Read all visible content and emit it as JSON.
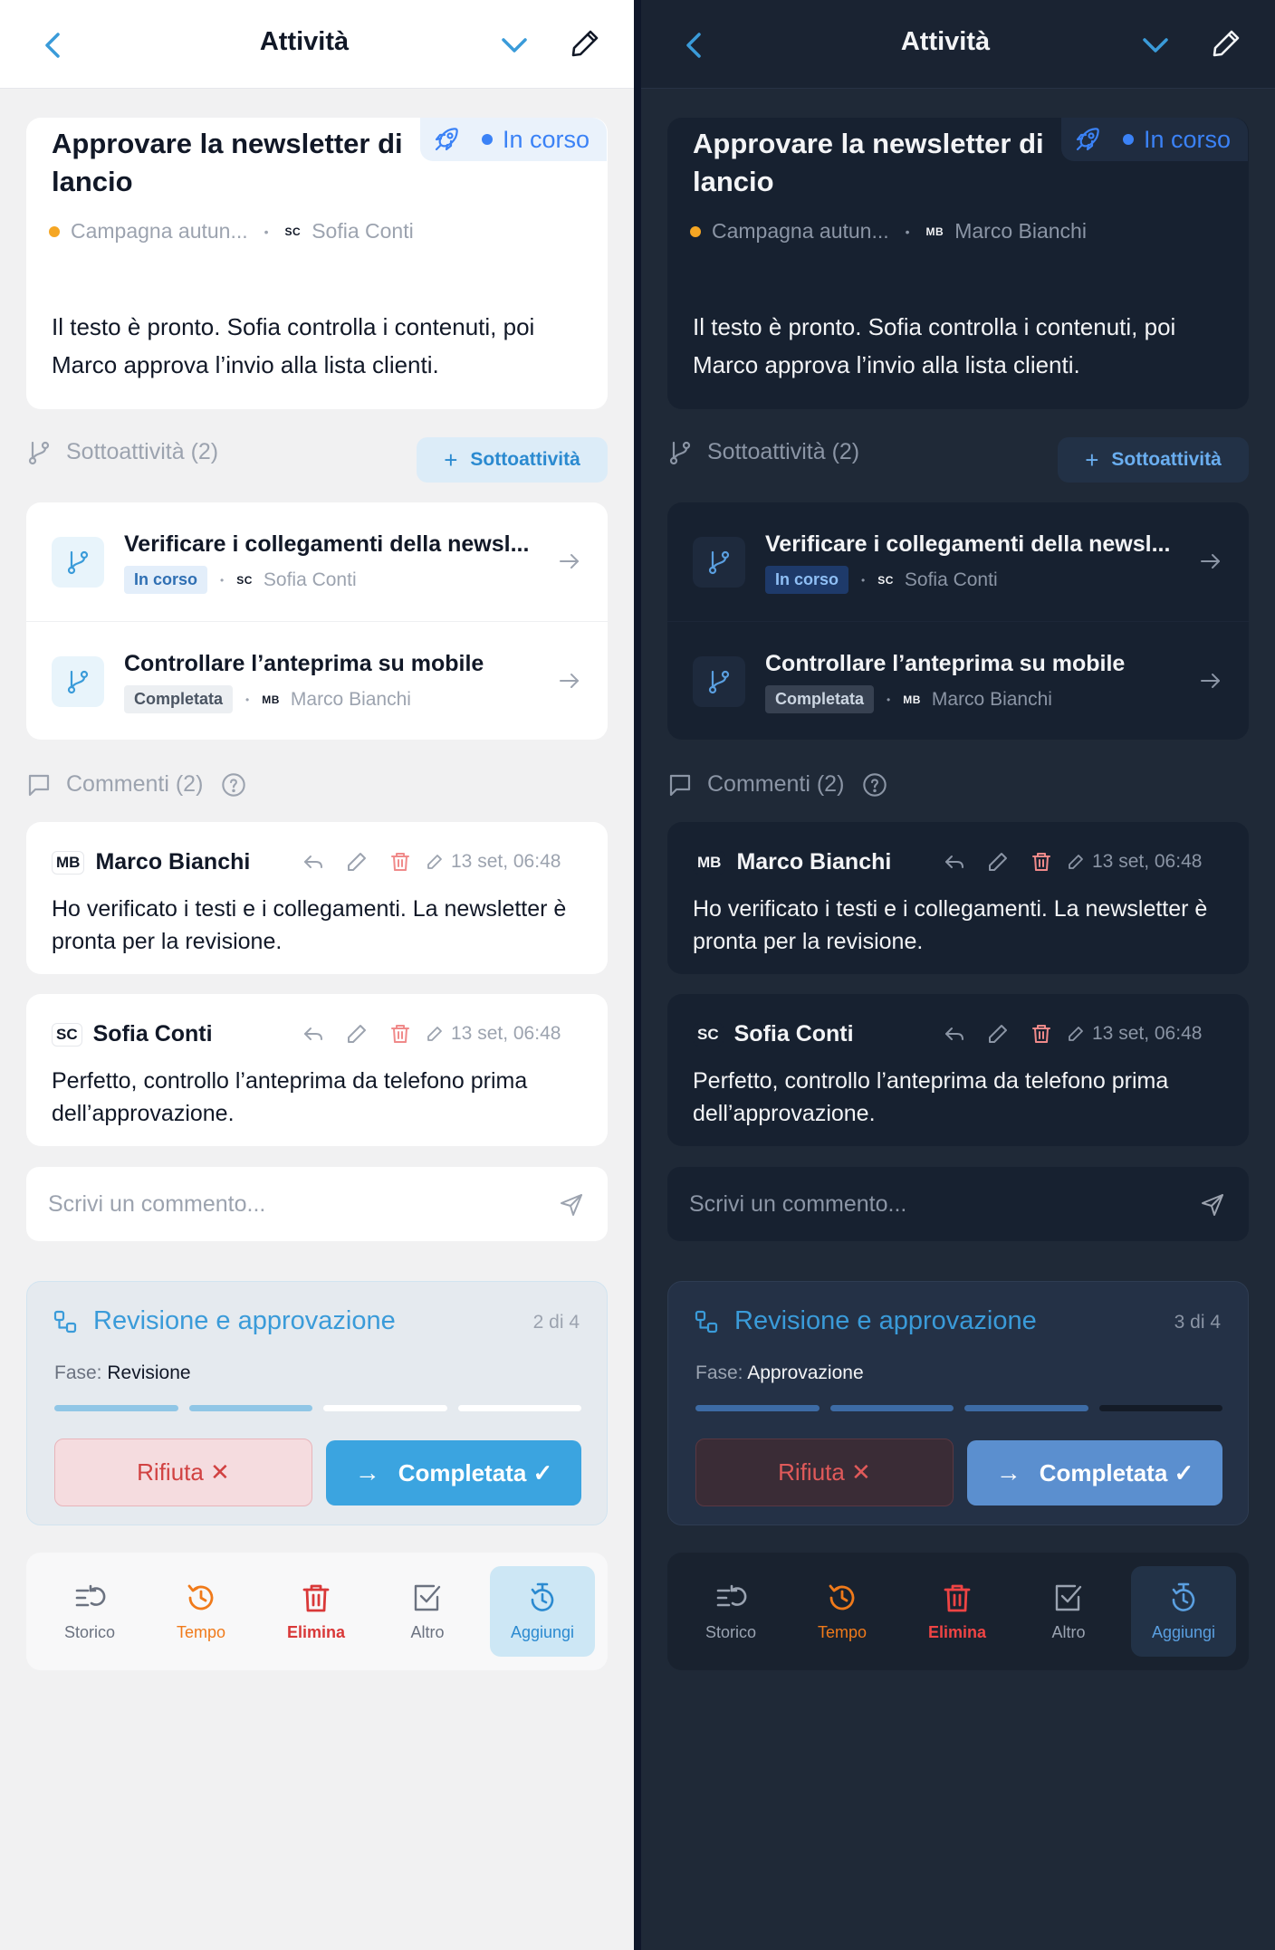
{
  "screens": {
    "light": {
      "header": {
        "title": "Attività"
      },
      "task": {
        "title": "Approvare la newsletter di lancio",
        "status": "In corso",
        "project": "Campagna autun...",
        "assignee_initials": "SC",
        "assignee": "Sofia Conti",
        "description": "Il testo è pronto. Sofia controlla i contenuti, poi Marco approva l’invio alla lista clienti."
      },
      "subtasks": {
        "heading": "Sottoattività (2)",
        "add_label": "Sottoattività",
        "items": [
          {
            "title": "Verificare i collegamenti della newsl...",
            "status": "In corso",
            "assignee_initials": "SC",
            "assignee": "Sofia Conti"
          },
          {
            "title": "Controllare l’anteprima su mobile",
            "status": "Completata",
            "assignee_initials": "MB",
            "assignee": "Marco Bianchi"
          }
        ]
      },
      "comments": {
        "heading": "Commenti (2)",
        "items": [
          {
            "initials": "MB",
            "author": "Marco Bianchi",
            "date": "13 set, 06:48",
            "text": "Ho verificato i testi e i collegamenti. La newsletter è pronta per la revisione."
          },
          {
            "initials": "SC",
            "author": "Sofia Conti",
            "date": "13 set, 06:48",
            "text": "Perfetto, controllo l’anteprima da telefono prima dell’approvazione."
          }
        ],
        "input_placeholder": "Scrivi un commento..."
      },
      "workflow": {
        "title": "Revisione e approvazione",
        "step": "2 di 4",
        "phase_label": "Fase:",
        "phase": "Revisione",
        "progress": [
          1,
          1,
          0,
          0
        ],
        "reject_label": "Rifiuta ✕",
        "complete_label": "Completata ✓"
      },
      "nav": [
        {
          "label": "Storico",
          "icon": "history-list-icon",
          "color": "#6b7280"
        },
        {
          "label": "Tempo",
          "icon": "clock-history-icon",
          "color": "#f07a1a"
        },
        {
          "label": "Elimina",
          "icon": "trash-icon",
          "color": "#d93838"
        },
        {
          "label": "Altro",
          "icon": "checkbox-icon",
          "color": "#6b7280"
        },
        {
          "label": "Aggiungi",
          "icon": "timer-icon",
          "color": "#2b8ad0",
          "active": true
        }
      ]
    },
    "dark": {
      "header": {
        "title": "Attività"
      },
      "task": {
        "title": "Approvare la newsletter di lancio",
        "status": "In corso",
        "project": "Campagna autun...",
        "assignee_initials": "MB",
        "assignee": "Marco Bianchi",
        "description": "Il testo è pronto. Sofia controlla i contenuti, poi Marco approva l’invio alla lista clienti."
      },
      "subtasks": {
        "heading": "Sottoattività (2)",
        "add_label": "Sottoattività",
        "items": [
          {
            "title": "Verificare i collegamenti della newsl...",
            "status": "In corso",
            "assignee_initials": "SC",
            "assignee": "Sofia Conti"
          },
          {
            "title": "Controllare l’anteprima su mobile",
            "status": "Completata",
            "assignee_initials": "MB",
            "assignee": "Marco Bianchi"
          }
        ]
      },
      "comments": {
        "heading": "Commenti (2)",
        "items": [
          {
            "initials": "MB",
            "author": "Marco Bianchi",
            "date": "13 set, 06:48",
            "text": "Ho verificato i testi e i collegamenti. La newsletter è pronta per la revisione."
          },
          {
            "initials": "SC",
            "author": "Sofia Conti",
            "date": "13 set, 06:48",
            "text": "Perfetto, controllo l’anteprima da telefono prima dell’approvazione."
          }
        ],
        "input_placeholder": "Scrivi un commento..."
      },
      "workflow": {
        "title": "Revisione e approvazione",
        "step": "3 di 4",
        "phase_label": "Fase:",
        "phase": "Approvazione",
        "progress": [
          1,
          1,
          1,
          0
        ],
        "reject_label": "Rifiuta ✕",
        "complete_label": "Completata ✓"
      },
      "nav": [
        {
          "label": "Storico",
          "icon": "history-list-icon",
          "color": "#9aa3b1"
        },
        {
          "label": "Tempo",
          "icon": "clock-history-icon",
          "color": "#f07a1a"
        },
        {
          "label": "Elimina",
          "icon": "trash-icon",
          "color": "#ef4444"
        },
        {
          "label": "Altro",
          "icon": "checkbox-icon",
          "color": "#9aa3b1"
        },
        {
          "label": "Aggiungi",
          "icon": "timer-icon",
          "color": "#5a9fe0",
          "active": true
        }
      ]
    }
  }
}
